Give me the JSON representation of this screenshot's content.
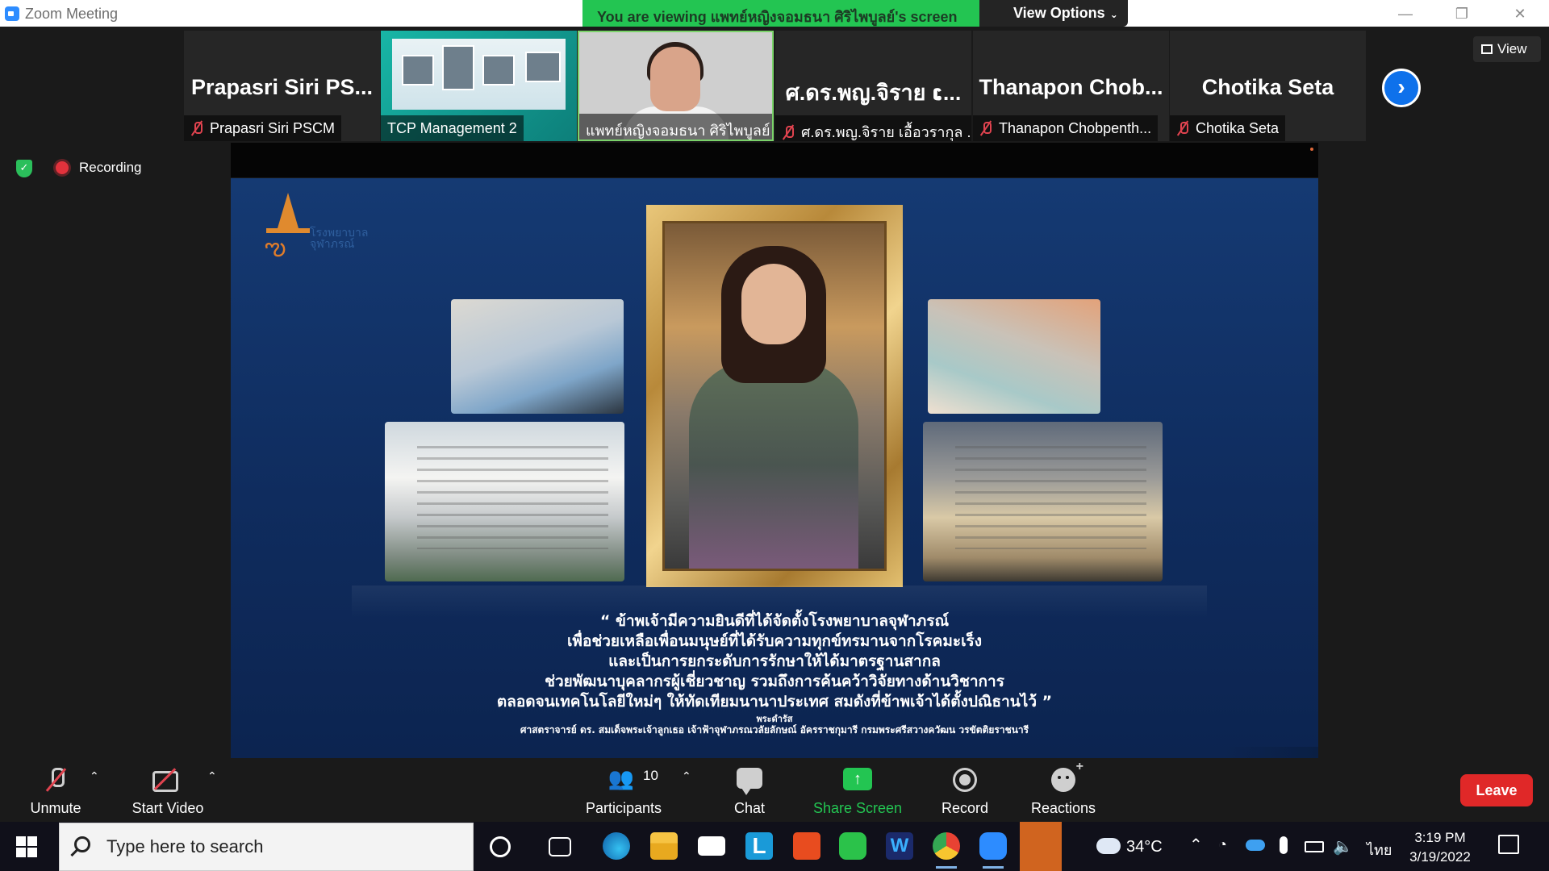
{
  "window": {
    "title": "Zoom Meeting",
    "viewing_banner": "You are viewing แพทย์หญิงจอมธนา ศิริไพบูลย์'s screen",
    "view_options_label": "View Options",
    "view_label": "View"
  },
  "gallery": {
    "tiles": [
      {
        "name": "Prapasri Siri PS...",
        "label": "Prapasri Siri PSCM",
        "muted": true
      },
      {
        "name": "",
        "label": "TCP Management 2",
        "muted": false
      },
      {
        "name": "",
        "label": "แพทย์หญิงจอมธนา ศิริไพบูลย์",
        "muted": false
      },
      {
        "name": "ศ.ดร.พญ.จิราย ເ...",
        "label": "ศ.ดร.พญ.จิราย เอื้อวรากุล ...",
        "muted": true
      },
      {
        "name": "Thanapon  Chob...",
        "label": "Thanapon Chobpenth...",
        "muted": true
      },
      {
        "name": "Chotika Seta",
        "label": "Chotika Seta",
        "muted": true
      }
    ]
  },
  "recording": {
    "label": "Recording"
  },
  "slide": {
    "logo_text": "โรงพยาบาล จุฬาภรณ์",
    "quote_lines": [
      "“ ข้าพเจ้ามีความยินดีที่ได้จัดตั้งโรงพยาบาลจุฬาภรณ์",
      "เพื่อช่วยเหลือเพื่อนมนุษย์ที่ได้รับความทุกข์ทรมานจากโรคมะเร็ง",
      "และเป็นการยกระดับการรักษาให้ได้มาตรฐานสากล",
      "ช่วยพัฒนาบุคลากรผู้เชี่ยวชาญ รวมถึงการค้นคว้าวิจัยทางด้านวิชาการ",
      "ตลอดจนเทคโนโลยีใหม่ๆ ให้ทัดเทียมนานาประเทศ สมดังที่ข้าพเจ้าได้ตั้งปณิธานไว้ ”"
    ],
    "quote_title": "พระดำรัส",
    "quote_author": "ศาสตราจารย์ ดร. สมเด็จพระเจ้าลูกเธอ เจ้าฟ้าจุฬาภรณวลัยลักษณ์ อัครราชกุมารี กรมพระศรีสวางควัฒน วรขัตติยราชนารี"
  },
  "controls": {
    "unmute_label": "Unmute",
    "start_video_label": "Start Video",
    "participants_label": "Participants",
    "participants_count": "10",
    "chat_label": "Chat",
    "share_screen_label": "Share Screen",
    "record_label": "Record",
    "reactions_label": "Reactions",
    "leave_label": "Leave"
  },
  "taskbar": {
    "search_placeholder": "Type here to search",
    "weather_temp": "34°C",
    "language": "ไทย",
    "time": "3:19 PM",
    "date": "3/19/2022"
  },
  "colors": {
    "zoom_blue": "#2d8cff",
    "share_green": "#23c552",
    "leave_red": "#e02828",
    "slide_blue": "#153a73"
  }
}
